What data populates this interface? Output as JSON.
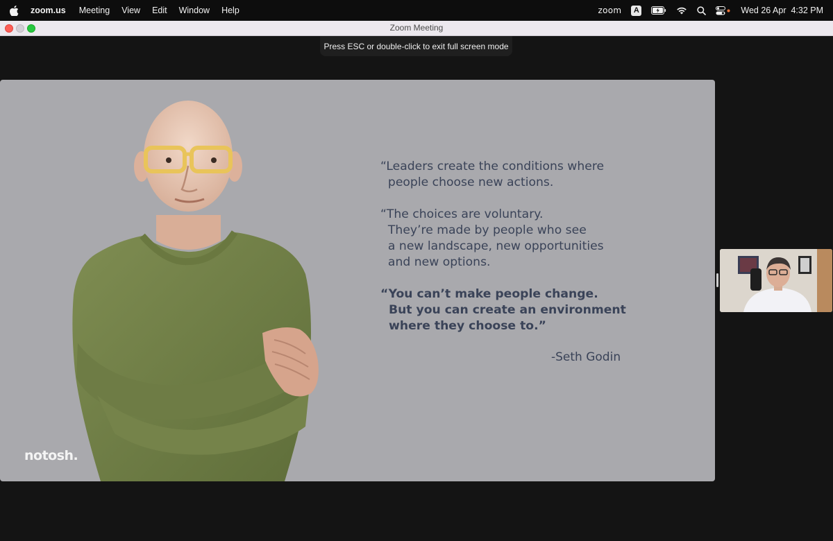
{
  "menubar": {
    "app_name": "zoom.us",
    "menus": [
      "Meeting",
      "View",
      "Edit",
      "Window",
      "Help"
    ],
    "status_zoom": "zoom",
    "input_source": "A",
    "date": "Wed 26 Apr",
    "time": "4:32 PM"
  },
  "window": {
    "title": "Zoom Meeting"
  },
  "fullscreen_notice": "Press ESC or double-click to exit full screen mode",
  "slide": {
    "quotes": [
      "“Leaders create the conditions where\n  people choose new actions.",
      "“The choices are voluntary.\n  They’re made by people who see\n  a new landscape, new opportunities\n  and new options."
    ],
    "bold_quote": "“You can’t make people change.\n  But you can create an environment\n  where they choose to.”",
    "attribution": "-Seth Godin",
    "logo": "notosh."
  },
  "colors": {
    "slide_bg": "#a9a9ad",
    "quote_text": "#3a4358",
    "close": "#fd5f57",
    "maximize": "#28c840",
    "menubar_bg": "#0d0d0d",
    "window_bg": "#141414"
  }
}
